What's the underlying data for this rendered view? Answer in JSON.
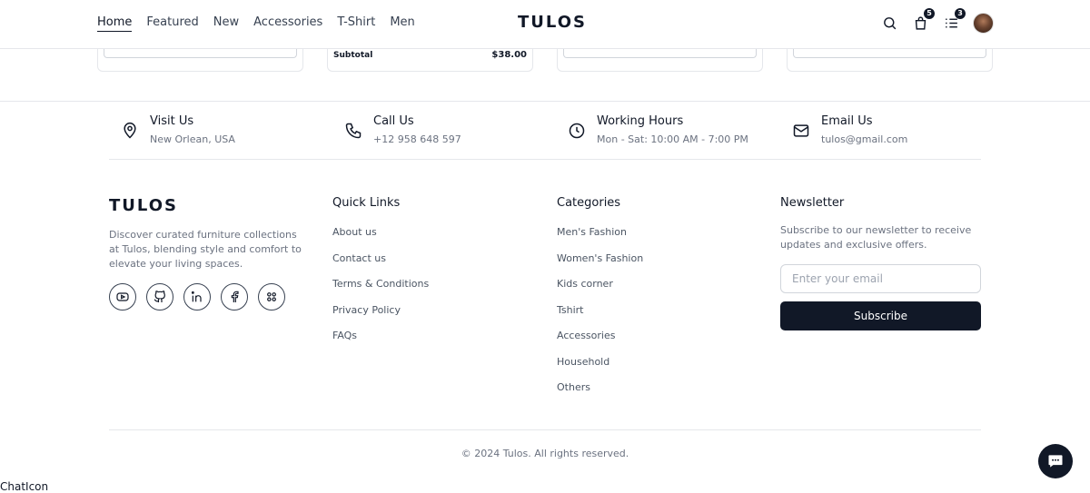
{
  "header": {
    "nav": [
      {
        "label": "Home",
        "active": true
      },
      {
        "label": "Featured"
      },
      {
        "label": "New"
      },
      {
        "label": "Accessories"
      },
      {
        "label": "T-Shirt"
      },
      {
        "label": "Men"
      }
    ],
    "brand": "TULOS",
    "icons": {
      "search": "search-icon",
      "cart": "shopping-bag-icon",
      "list": "list-icon"
    },
    "cart_count": "5",
    "list_count": "3"
  },
  "cards": {
    "subtotal_label": "Subtotal",
    "subtotal_value": "$38.00"
  },
  "contact": [
    {
      "title": "Visit Us",
      "detail": "New Orlean, USA",
      "icon": "map-pin-icon"
    },
    {
      "title": "Call Us",
      "detail": "+12 958 648 597",
      "icon": "phone-icon"
    },
    {
      "title": "Working Hours",
      "detail": "Mon - Sat: 10:00 AM - 7:00 PM",
      "icon": "clock-icon"
    },
    {
      "title": "Email Us",
      "detail": "tulos@gmail.com",
      "icon": "mail-icon"
    }
  ],
  "footer": {
    "brand": "TULOS",
    "description": "Discover curated furniture collections at Tulos, blending style and comfort to elevate your living spaces.",
    "socials": [
      "youtube-icon",
      "github-icon",
      "linkedin-icon",
      "facebook-icon",
      "dribbble-icon"
    ],
    "quick_links": {
      "title": "Quick Links",
      "items": [
        "About us",
        "Contact us",
        "Terms & Conditions",
        "Privacy Policy",
        "FAQs"
      ]
    },
    "categories": {
      "title": "Categories",
      "items": [
        "Men's Fashion",
        "Women's Fashion",
        "Kids corner",
        "Tshirt",
        "Accessories",
        "Household",
        "Others"
      ]
    },
    "newsletter": {
      "title": "Newsletter",
      "description": "Subscribe to our newsletter to receive updates and exclusive offers.",
      "placeholder": "Enter your email",
      "button": "Subscribe"
    },
    "copyright": "© 2024 Tulos. All rights reserved."
  },
  "chat": {
    "alt_text": "ChatIcon"
  }
}
